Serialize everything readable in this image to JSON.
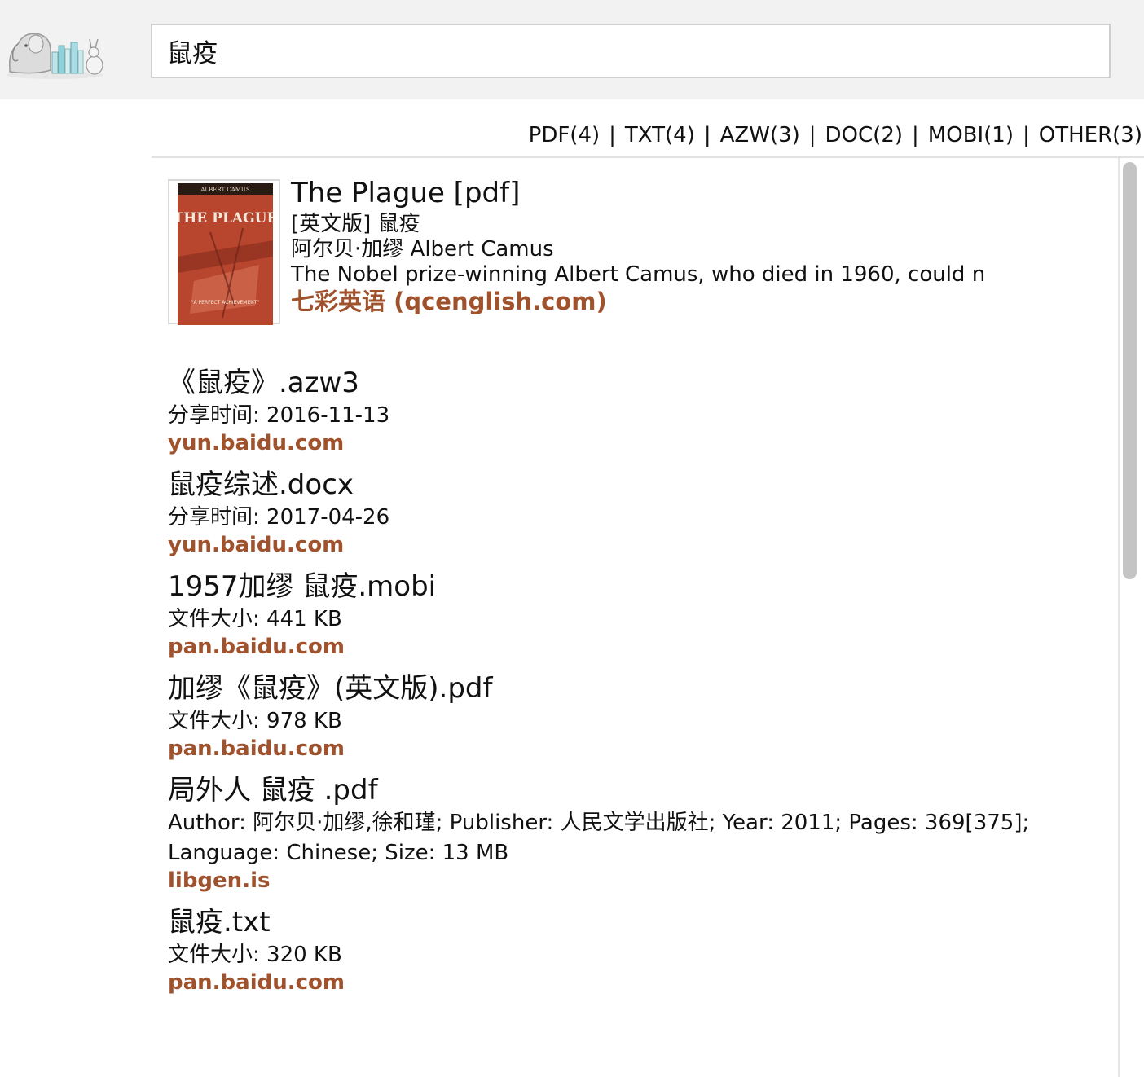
{
  "search": {
    "query": "鼠疫"
  },
  "filters": [
    {
      "label": "PDF(4)"
    },
    {
      "label": "TXT(4)"
    },
    {
      "label": "AZW(3)"
    },
    {
      "label": "DOC(2)"
    },
    {
      "label": "MOBI(1)"
    },
    {
      "label": "OTHER(3)"
    }
  ],
  "filter_separator": "|",
  "featured": {
    "cover": {
      "author_band": "ALBERT CAMUS",
      "title": "THE PLAGUE",
      "tagline": "\"A PERFECT ACHIEVEMENT\""
    },
    "title": "The Plague [pdf]",
    "subtitle": "[英文版] 鼠疫",
    "author": "阿尔贝·加缪 Albert Camus",
    "description": "The Nobel prize-winning Albert Camus, who died in 1960, could n",
    "source": "七彩英语 (qcenglish.com)"
  },
  "results": [
    {
      "title": "《鼠疫》.azw3",
      "meta": "分享时间: 2016-11-13",
      "source": "yun.baidu.com"
    },
    {
      "title": "鼠疫综述.docx",
      "meta": "分享时间: 2017-04-26",
      "source": "yun.baidu.com"
    },
    {
      "title": "1957加缪 鼠疫.mobi",
      "meta": "文件大小: 441 KB",
      "source": "pan.baidu.com"
    },
    {
      "title": "加缪《鼠疫》(英文版).pdf",
      "meta": "文件大小: 978 KB",
      "source": "pan.baidu.com"
    },
    {
      "title": "局外人 鼠疫 .pdf",
      "meta": "Author: 阿尔贝·加缪,徐和瑾; Publisher: 人民文学出版社; Year: 2011; Pages: 369[375]; Language: Chinese; Size: 13 MB",
      "source": "libgen.is"
    },
    {
      "title": "鼠疫.txt",
      "meta": "文件大小: 320 KB",
      "source": "pan.baidu.com"
    }
  ],
  "colors": {
    "source_link": "#a0522d",
    "header_bg": "#f2f2f2",
    "cover_bg": "#b8452e"
  },
  "icons": {
    "logo": "elephant-books-logo-icon"
  }
}
